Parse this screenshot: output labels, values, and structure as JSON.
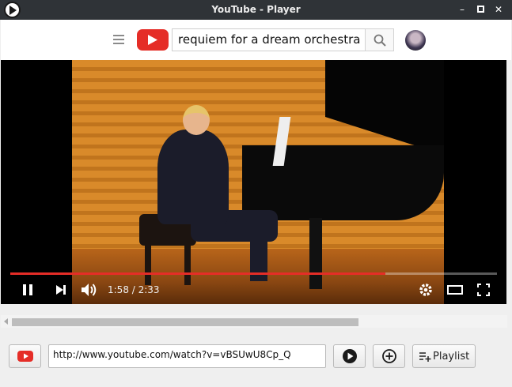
{
  "window": {
    "title": "YouTube - Player"
  },
  "header": {
    "search_query": "requiem for a dream orchestra"
  },
  "player": {
    "current_time": "1:58",
    "duration": "2:33",
    "time_display": "1:58 / 2:33",
    "progress": 0.77,
    "state": "playing"
  },
  "scrollbar": {
    "thumb_fraction": 0.7
  },
  "footer": {
    "url": "http://www.youtube.com/watch?v=vBSUwU8Cp_Q",
    "playlist_label": "Playlist"
  },
  "colors": {
    "accent": "#e52d27",
    "titlebar": "#2f3337"
  },
  "icons": [
    "app-play-icon",
    "minimize-icon",
    "maximize-icon",
    "close-icon",
    "menu-icon",
    "youtube-logo-icon",
    "search-icon",
    "pause-icon",
    "next-icon",
    "volume-icon",
    "settings-icon",
    "theater-icon",
    "fullscreen-icon",
    "youtube-icon",
    "play-circle-icon",
    "add-circle-icon",
    "playlist-add-icon"
  ]
}
